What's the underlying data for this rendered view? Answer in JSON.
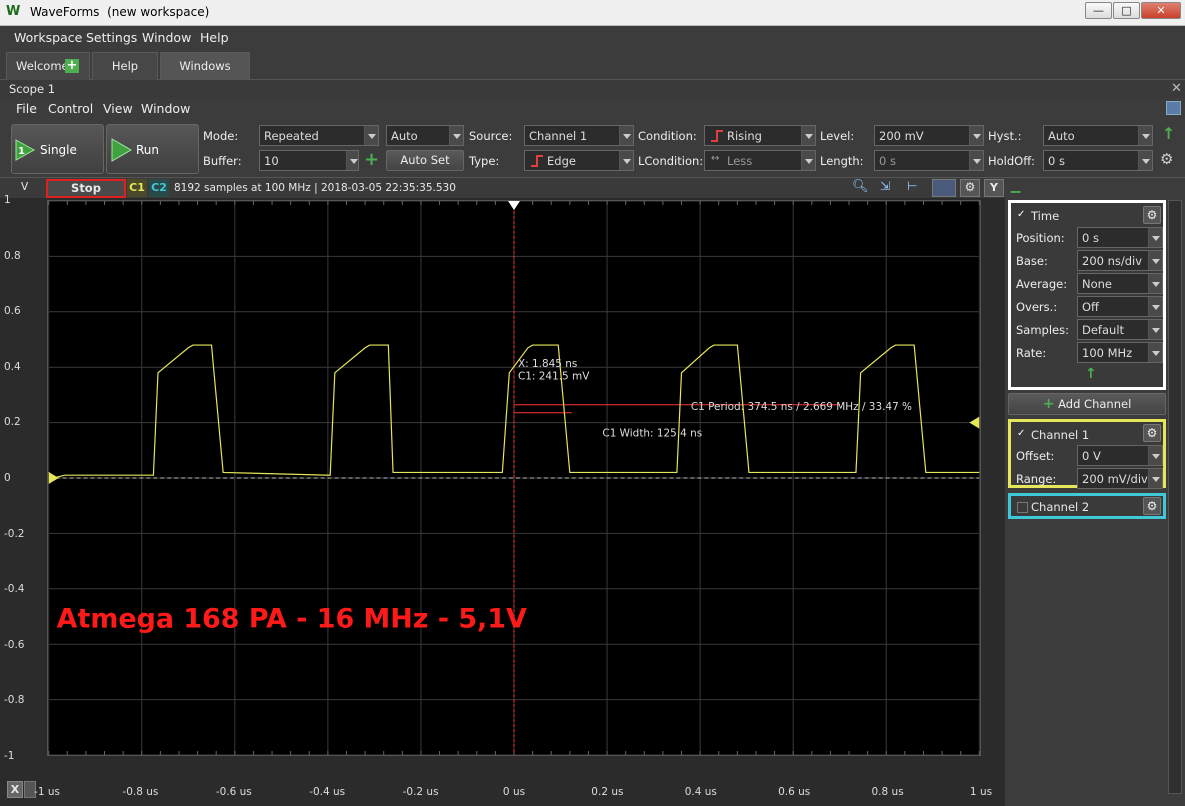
{
  "window": {
    "title": "WaveForms",
    "subtitle": "(new workspace)",
    "controls": [
      "—",
      "□",
      "✕"
    ]
  },
  "menu": [
    "Workspace",
    "Settings",
    "Window",
    "Help"
  ],
  "tabs": [
    "Welcome",
    "Help",
    "Windows"
  ],
  "scope": {
    "title": "Scope 1",
    "menu": [
      "File",
      "Control",
      "View",
      "Window"
    ]
  },
  "toolbar": {
    "single": "Single",
    "run": "Run",
    "mode_label": "Mode:",
    "mode_value": "Repeated",
    "buffer_label": "Buffer:",
    "buffer_value": "10",
    "trigger_auto": "Auto",
    "autoset": "Auto Set",
    "source_label": "Source:",
    "source_value": "Channel 1",
    "type_label": "Type:",
    "type_value": "Edge",
    "condition_label": "Condition:",
    "condition_value": "Rising",
    "lcondition_label": "LCondition:",
    "lcondition_value": "Less",
    "level_label": "Level:",
    "level_value": "200 mV",
    "length_label": "Length:",
    "length_value": "0 s",
    "hyst_label": "Hyst.:",
    "hyst_value": "Auto",
    "holdoff_label": "HoldOff:",
    "holdoff_value": "0 s"
  },
  "plot": {
    "unit": "V",
    "stop": "Stop",
    "c1": "C1",
    "c2": "C2",
    "status": "8192 samples at 100 MHz | 2018-03-05 22:35:35.530",
    "y_ticks": [
      "1",
      "0.8",
      "0.6",
      "0.4",
      "0.2",
      "0",
      "-0.2",
      "-0.4",
      "-0.6",
      "-0.8",
      "-1"
    ],
    "x_ticks": [
      "-1 us",
      "-0.8 us",
      "-0.6 us",
      "-0.4 us",
      "-0.2 us",
      "0 us",
      "0.2 us",
      "0.4 us",
      "0.6 us",
      "0.8 us",
      "1 us"
    ],
    "x_axis_btn": "X",
    "y_axis_btn": "Y",
    "cursor_x": "X: 1.845 ns",
    "cursor_c1": "C1: 241.5 mV",
    "period": "C1 Period: 374.5 ns / 2.669 MHz / 33.47 %",
    "width": "C1 Width: 125.4 ns",
    "annotation": "Atmega 168 PA - 16 MHz - 5,1V",
    "colors": {
      "c1": "#e6e65a",
      "c2": "#3ec8d8",
      "annotation": "#ff1a1a",
      "cursor": "#ff3030"
    }
  },
  "chart_data": {
    "type": "line",
    "xlim": [
      -1,
      1
    ],
    "ylim": [
      -1,
      1
    ],
    "xlabel": "",
    "ylabel": "V",
    "grid": true,
    "series": [
      {
        "name": "C1",
        "x": [
          -1,
          -0.99,
          -0.965,
          -0.775,
          -0.765,
          -0.7,
          -0.69,
          -0.65,
          -0.625,
          -0.395,
          -0.385,
          -0.32,
          -0.31,
          -0.27,
          -0.26,
          -0.025,
          -0.01,
          0.03,
          0.04,
          0.095,
          0.12,
          0.35,
          0.36,
          0.42,
          0.43,
          0.48,
          0.505,
          0.735,
          0.745,
          0.81,
          0.82,
          0.86,
          0.885,
          1
        ],
        "y": [
          0.02,
          0.0,
          0.01,
          0.01,
          0.38,
          0.47,
          0.48,
          0.48,
          0.02,
          0.01,
          0.38,
          0.47,
          0.48,
          0.48,
          0.02,
          0.02,
          0.38,
          0.47,
          0.48,
          0.48,
          0.02,
          0.02,
          0.38,
          0.47,
          0.48,
          0.48,
          0.02,
          0.02,
          0.38,
          0.47,
          0.48,
          0.48,
          0.02,
          0.02
        ]
      }
    ]
  },
  "panel": {
    "time_title": "Time",
    "rows": [
      {
        "label": "Position:",
        "value": "0 s"
      },
      {
        "label": "Base:",
        "value": "200 ns/div"
      },
      {
        "label": "Average:",
        "value": "None"
      },
      {
        "label": "Overs.:",
        "value": "Off"
      },
      {
        "label": "Samples:",
        "value": "Default"
      },
      {
        "label": "Rate:",
        "value": "100 MHz"
      }
    ],
    "add_channel": "Add Channel",
    "ch1_title": "Channel 1",
    "ch1_offset_label": "Offset:",
    "ch1_offset": "0 V",
    "ch1_range_label": "Range:",
    "ch1_range": "200 mV/div",
    "ch2_title": "Channel 2"
  }
}
